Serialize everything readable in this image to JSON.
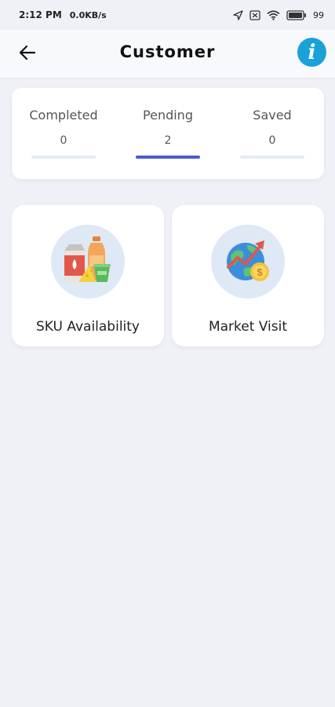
{
  "status_bar": {
    "time": "2:12 PM",
    "speed": "0.0KB/s",
    "battery": "99"
  },
  "header": {
    "title": "Customer",
    "info_symbol": "i"
  },
  "stats": [
    {
      "label": "Completed",
      "value": "0"
    },
    {
      "label": "Pending",
      "value": "2"
    },
    {
      "label": "Saved",
      "value": "0"
    }
  ],
  "tiles": [
    {
      "label": "SKU Availability",
      "icon": "grocery-products-icon"
    },
    {
      "label": "Market Visit",
      "icon": "globe-growth-icon"
    }
  ],
  "colors": {
    "background": "#eff1f6",
    "info_button": "#1aa2d8",
    "active_tab_bar": "#4a5bd4",
    "inactive_tab_bar": "#e6ebf7"
  }
}
